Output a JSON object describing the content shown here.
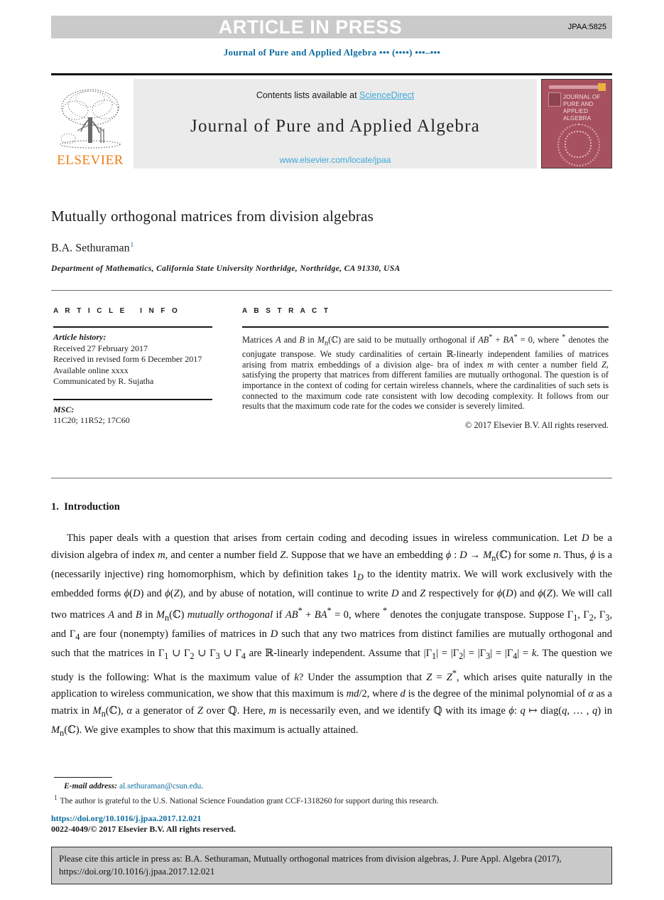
{
  "banner": {
    "text": "ARTICLE IN PRESS",
    "article_code": "JPAA:5825",
    "bg_color": "#cacaca",
    "text_color": "#ffffff"
  },
  "running_head": "Journal of Pure and Applied Algebra ••• (••••) •••–•••",
  "masthead": {
    "contents_prefix": "Contents lists available at ",
    "sciencedirect_link": "ScienceDirect",
    "journal_title": "Journal of Pure and Applied Algebra",
    "journal_url": "www.elsevier.com/locate/jpaa",
    "publisher_wordmark": "ELSEVIER",
    "cover_title_lines": [
      "JOURNAL OF",
      "PURE AND",
      "APPLIED ALGEBRA"
    ],
    "link_color": "#3ba7d8",
    "elsevier_orange": "#f07c1a",
    "cover_color": "#a8515e"
  },
  "article": {
    "title": "Mutually orthogonal matrices from division algebras",
    "author": "B.A. Sethuraman",
    "author_footnote_mark": "1",
    "affiliation": "Department of Mathematics, California State University Northridge, Northridge, CA 91330, USA"
  },
  "article_info": {
    "heading": "ARTICLE INFO",
    "history_label": "Article history:",
    "history": [
      "Received 27 February 2017",
      "Received in revised form 6 December 2017",
      "Available online xxxx",
      "Communicated by R. Sujatha"
    ],
    "msc_label": "MSC:",
    "msc_codes": "11C20; 11R52; 17C60"
  },
  "abstract": {
    "heading": "ABSTRACT",
    "body": "Matrices A and B in Mn(C) are said to be mutually orthogonal if AB* + BA* = 0, where * denotes the conjugate transpose. We study cardinalities of certain R-linearly independent families of matrices arising from matrix embeddings of a division algebra of index m with center a number field Z, satisfying the property that matrices from different families are mutually orthogonal. The question is of importance in the context of coding for certain wireless channels, where the cardinalities of such sets is connected to the maximum code rate consistent with low decoding complexity. It follows from our results that the maximum code rate for the codes we consider is severely limited.",
    "copyright": "© 2017 Elsevier B.V. All rights reserved."
  },
  "introduction": {
    "section_number": "1.",
    "section_title": "Introduction",
    "paragraph": "This paper deals with a question that arises from certain coding and decoding issues in wireless communication. Let D be a division algebra of index m, and center a number field Z. Suppose that we have an embedding ϕ : D → Mn(C) for some n. Thus, ϕ is a (necessarily injective) ring homomorphism, which by definition takes 1D to the identity matrix. We will work exclusively with the embedded forms ϕ(D) and ϕ(Z), and by abuse of notation, will continue to write D and Z respectively for ϕ(D) and ϕ(Z). We will call two matrices A and B in Mn(C) mutually orthogonal if AB* + BA* = 0, where * denotes the conjugate transpose. Suppose Γ₁, Γ₂, Γ₃, and Γ₄ are four (nonempty) families of matrices in D such that any two matrices from distinct families are mutually orthogonal and such that the matrices in Γ₁ ∪ Γ₂ ∪ Γ₃ ∪ Γ₄ are R-linearly independent. Assume that |Γ₁| = |Γ₂| = |Γ₃| = |Γ₄| = k. The question we study is the following: What is the maximum value of k? Under the assumption that Z = Z*, which arises quite naturally in the application to wireless communication, we show that this maximum is md/2, where d is the degree of the minimal polynomial of α as a matrix in Mn(C), α a generator of Z over Q. Here, m is necessarily even, and we identify Q with its image ϕ: q ↦ diag(q, … , q) in Mn(C). We give examples to show that this maximum is actually attained."
  },
  "footnotes": {
    "email_label": "E-mail address:",
    "email": "al.sethuraman@csun.edu",
    "email_suffix": ".",
    "mark": "1",
    "grant_text": "The author is grateful to the U.S. National Science Foundation grant CCF-1318260 for support during this research."
  },
  "footer": {
    "doi": "https://doi.org/10.1016/j.jpaa.2017.12.021",
    "issn_line": "0022-4049/© 2017 Elsevier B.V. All rights reserved."
  },
  "cite_box": {
    "text": "Please cite this article in press as: B.A. Sethuraman, Mutually orthogonal matrices from division algebras, J. Pure Appl. Algebra (2017), https://doi.org/10.1016/j.jpaa.2017.12.021",
    "bg_color": "#c9c9c9"
  }
}
